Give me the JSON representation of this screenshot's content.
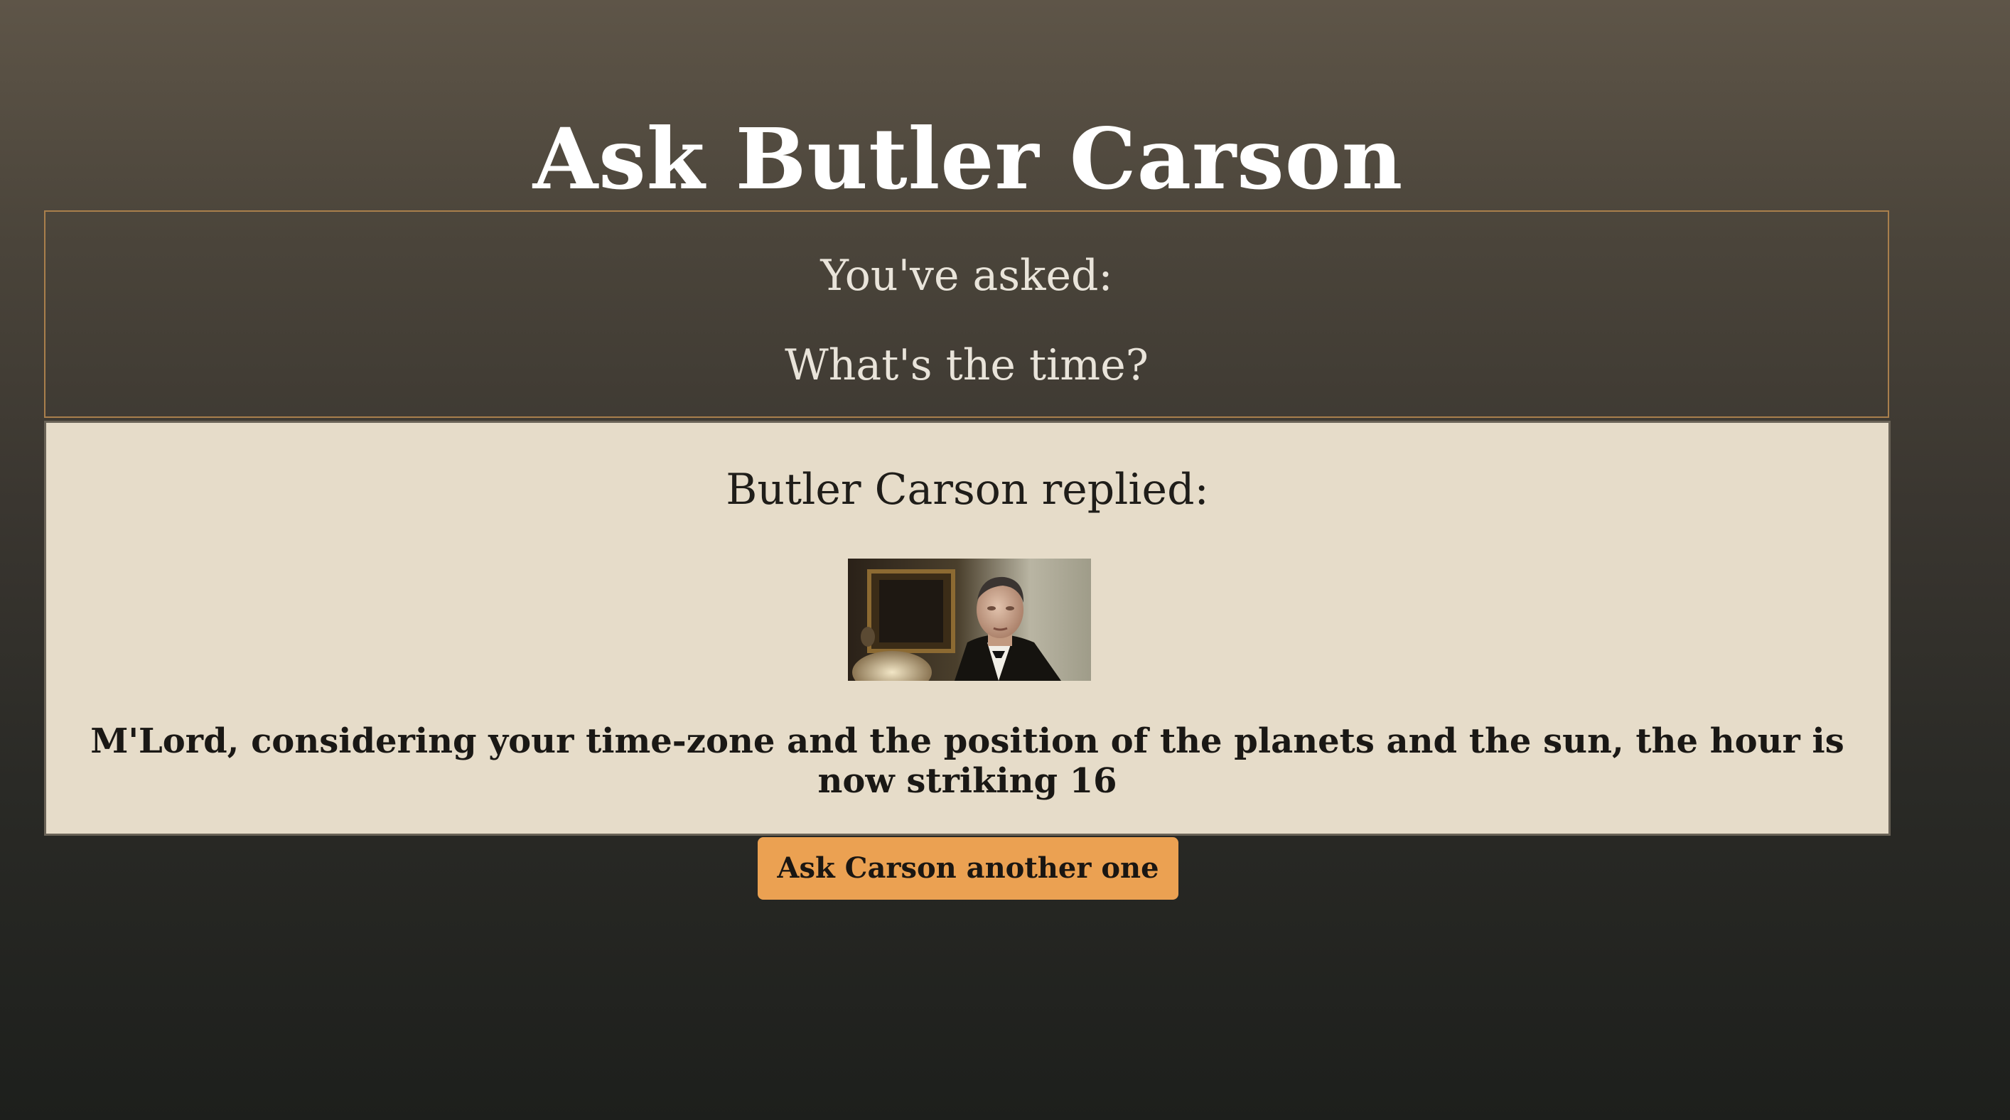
{
  "page": {
    "title": "Ask Butler Carson"
  },
  "question": {
    "label": "You've asked:",
    "text": "What's the time?"
  },
  "reply": {
    "label": "Butler Carson replied:",
    "text": "M'Lord, considering your time-zone and the position of the planets and the sun, the hour is now striking 16"
  },
  "portrait": {
    "icon": "butler-portrait-photo"
  },
  "actions": {
    "ask_again_label": "Ask Carson another one"
  },
  "colors": {
    "accent_button": "#eba152",
    "reply_panel": "#e6dcc9",
    "question_border": "#a97f4c"
  }
}
